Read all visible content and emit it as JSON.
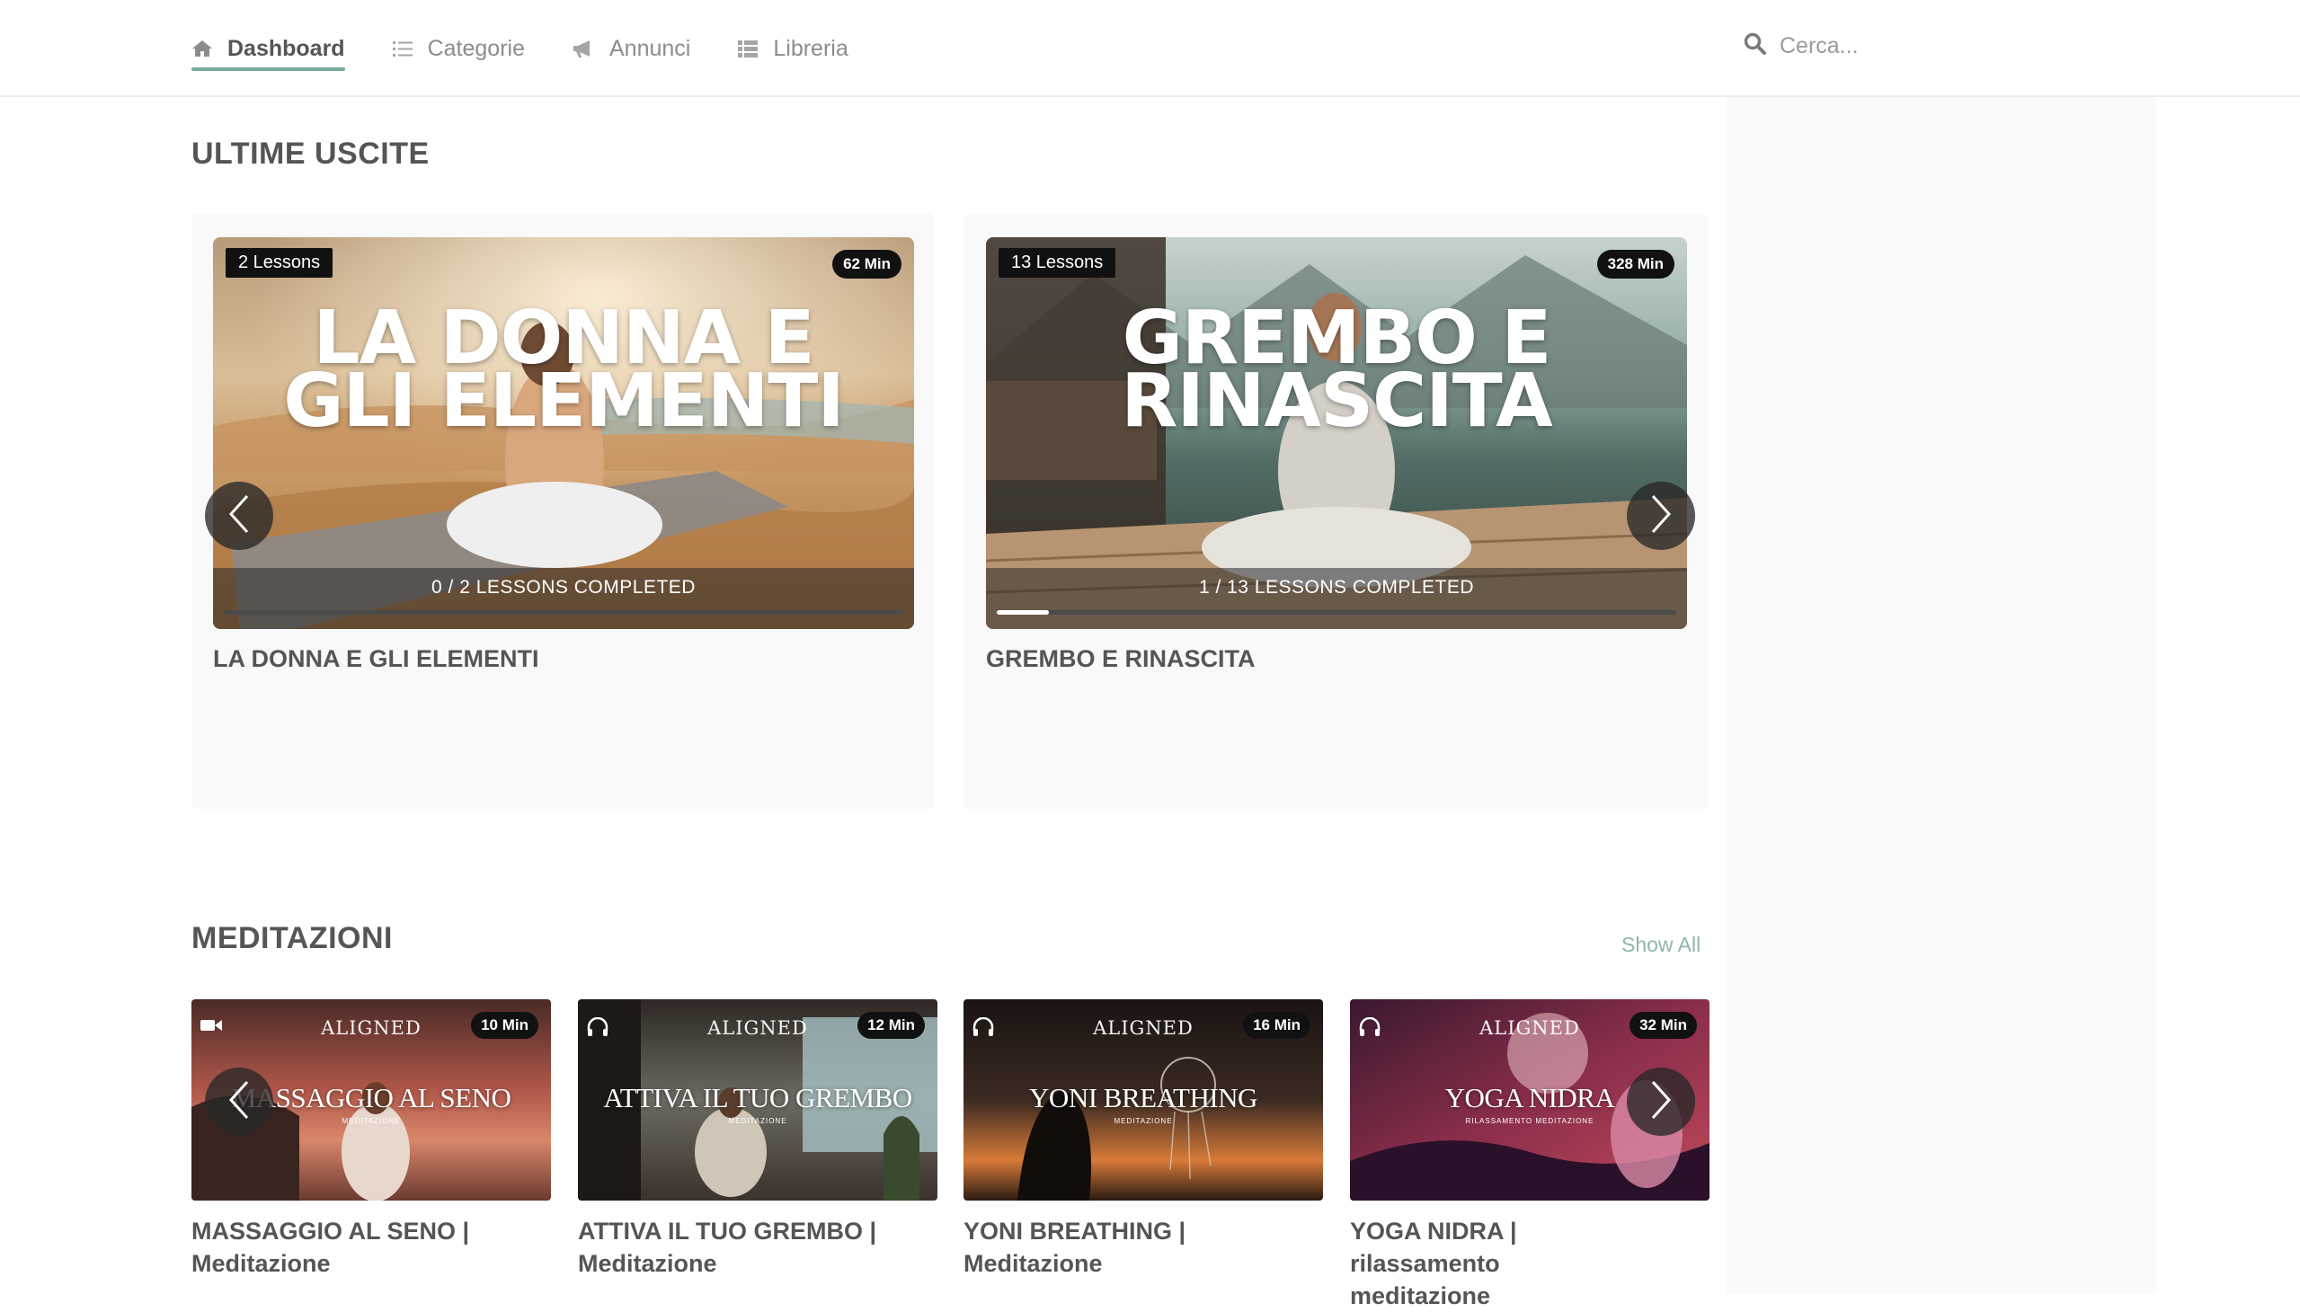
{
  "nav": {
    "items": [
      {
        "label": "Dashboard",
        "icon": "home-icon",
        "active": true
      },
      {
        "label": "Categorie",
        "icon": "list-icon",
        "active": false
      },
      {
        "label": "Annunci",
        "icon": "megaphone-icon",
        "active": false
      },
      {
        "label": "Libreria",
        "icon": "grid-list-icon",
        "active": false
      }
    ]
  },
  "search": {
    "placeholder": "Cerca..."
  },
  "colors": {
    "accent": "#7ba8a0",
    "show_all": "#8fb5ae",
    "text": "#555555"
  },
  "latest": {
    "title": "ULTIME USCITE",
    "courses": [
      {
        "lessons_badge": "2 Lessons",
        "duration_badge": "62 Min",
        "thumb_title_line1": "LA DONNA E",
        "thumb_title_line2": "GLI ELEMENTI",
        "progress_text": "0 / 2  LESSONS COMPLETED",
        "progress_fraction": 0.0,
        "title": "LA DONNA E GLI ELEMENTI"
      },
      {
        "lessons_badge": "13 Lessons",
        "duration_badge": "328 Min",
        "thumb_title_line1": "GREMBO E",
        "thumb_title_line2": "RINASCITA",
        "progress_text": "1 / 13  LESSONS COMPLETED",
        "progress_fraction": 0.077,
        "title": "GREMBO E RINASCITA"
      }
    ]
  },
  "meditations": {
    "title": "MEDITAZIONI",
    "show_all": "Show All",
    "items": [
      {
        "media_icon": "video-icon",
        "duration": "10 Min",
        "brand": "ALIGNED",
        "big": "MASSAGGIO AL SENO",
        "sub": "MEDITAZIONE",
        "title_line1": "MASSAGGIO AL SENO |",
        "title_line2": "Meditazione"
      },
      {
        "media_icon": "headphones-icon",
        "duration": "12 Min",
        "brand": "ALIGNED",
        "big": "ATTIVA IL TUO GREMBO",
        "sub": "MEDITAZIONE",
        "title_line1": "ATTIVA IL TUO GREMBO |",
        "title_line2": "Meditazione"
      },
      {
        "media_icon": "headphones-icon",
        "duration": "16 Min",
        "brand": "ALIGNED",
        "big": "YONI BREATHING",
        "sub": "MEDITAZIONE",
        "title_line1": "YONI BREATHING |",
        "title_line2": "Meditazione"
      },
      {
        "media_icon": "headphones-icon",
        "duration": "32 Min",
        "brand": "ALIGNED",
        "big": "YOGA NIDRA",
        "sub": "RILASSAMENTO MEDITAZIONE",
        "title_line1": "YOGA NIDRA |",
        "title_line2": "rilassamento",
        "title_line3": "meditazione"
      }
    ]
  }
}
